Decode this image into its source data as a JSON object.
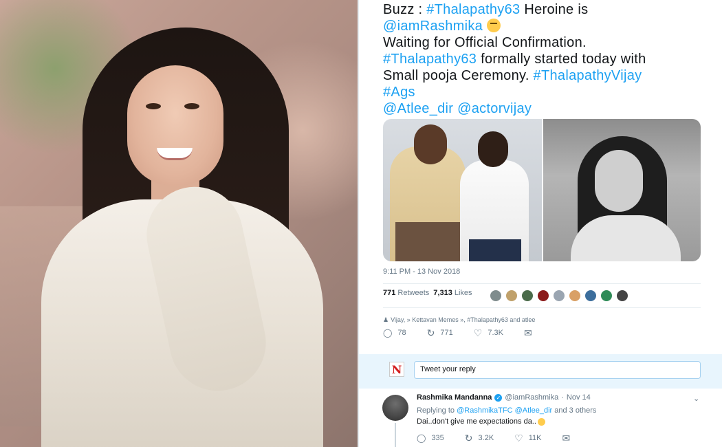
{
  "tweet": {
    "lines": {
      "l1_prefix": "Buzz : ",
      "l1_tag": "#Thalapathy63",
      "l1_suffix": " Heroine is",
      "l2_mention": "@iamRashmika",
      "l3": "Waiting for Official Confirmation.",
      "l4_tag": "#Thalapathy63",
      "l4_suffix": " formally started today with",
      "l5_prefix": "Small pooja Ceremony. ",
      "l5_tag": "#ThalapathyVijay",
      "l6_tag": "#Ags",
      "l7_mention1": "@Atlee_dir",
      "l7_mention2": "@actorvijay"
    },
    "timestamp": "9:11 PM - 13 Nov 2018",
    "retweets_count": "771",
    "retweets_label": "Retweets",
    "likes_count": "7,313",
    "likes_label": "Likes",
    "context": "Vijay, » Kettavan Memes », #Thalapathy63 and atlee",
    "actions": {
      "replies": "78",
      "retweets": "771",
      "likes": "7.3K"
    },
    "avatar_colors": [
      "#7f8c8d",
      "#c0a16b",
      "#4a6b4a",
      "#8b1a1a",
      "#9aa5b1",
      "#d9a066",
      "#3c6e9c",
      "#2e8b57",
      "#444444"
    ]
  },
  "reply_box": {
    "logo": "N",
    "placeholder": "Tweet your reply"
  },
  "reply": {
    "name": "Rashmika Mandanna",
    "handle": "@iamRashmika",
    "dot": "·",
    "date": "Nov 14",
    "replying_prefix": "Replying to ",
    "replying_m1": "@RashmikaTFC",
    "replying_m2": "@Atlee_dir",
    "replying_suffix": " and 3 others",
    "text": "Dai..don't give me expectations da..",
    "actions": {
      "replies": "335",
      "retweets": "3.2K",
      "likes": "11K"
    }
  },
  "icons": {
    "reply": "◯",
    "retweet": "↻",
    "like": "♡",
    "message": "✉",
    "chevron": "⌄",
    "people": "♟",
    "verified": "✓"
  }
}
